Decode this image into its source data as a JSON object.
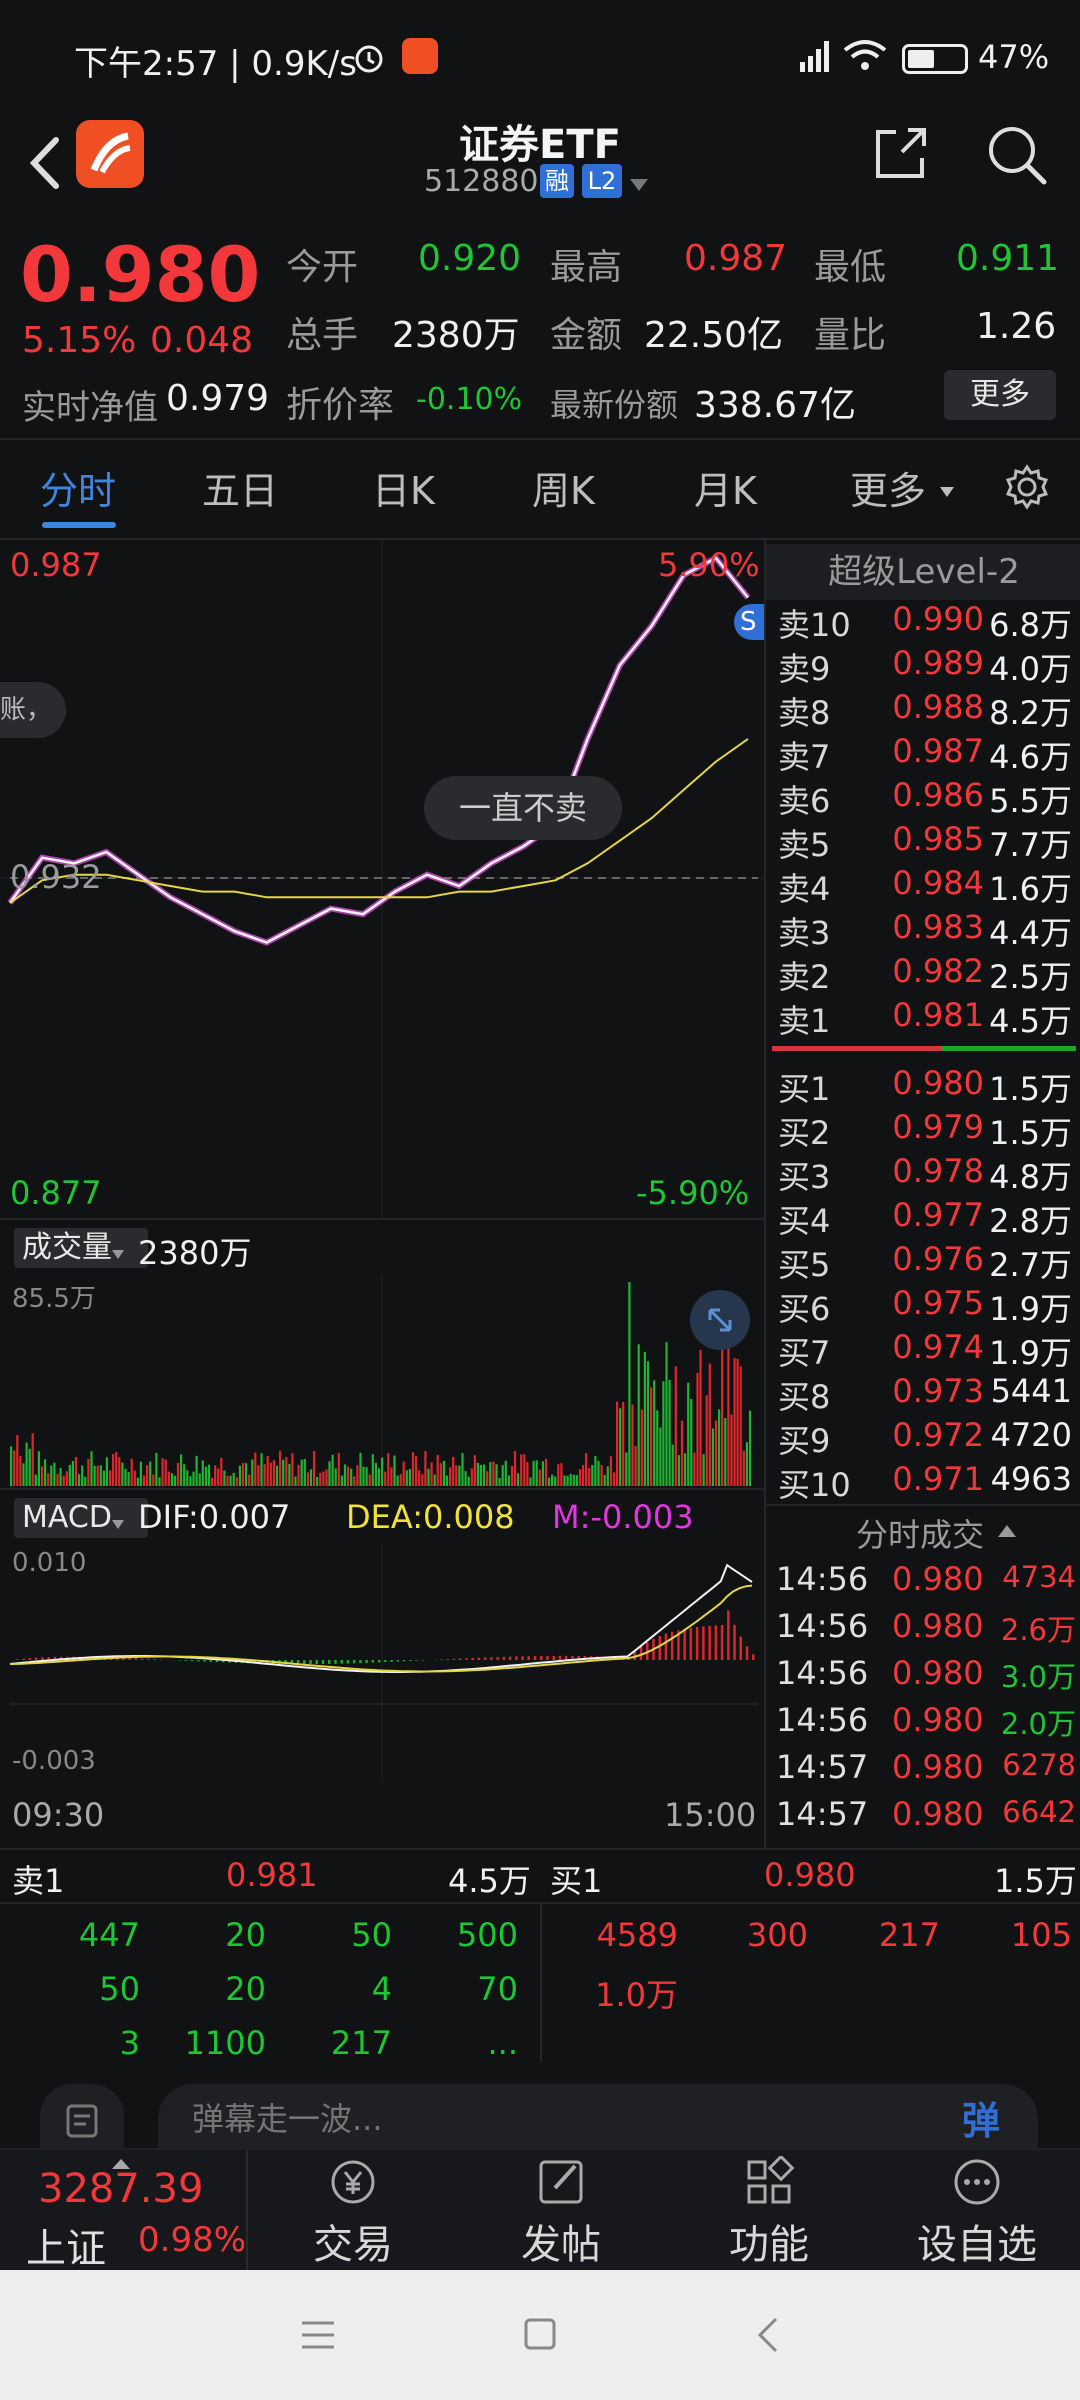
{
  "status_bar": {
    "time_speed": "下午2:57 | 0.9K/s",
    "battery": "47%"
  },
  "header": {
    "title": "证券ETF",
    "code": "512880",
    "badge_rong": "融",
    "badge_l2": "L2"
  },
  "quote": {
    "price": "0.980",
    "change_pct": "5.15%",
    "change_abs": "0.048",
    "nav_label": "实时净值",
    "nav_value": "0.979",
    "open_label": "今开",
    "open_value": "0.920",
    "high_label": "最高",
    "high_value": "0.987",
    "low_label": "最低",
    "low_value": "0.911",
    "hand_label": "总手",
    "hand_value": "2380万",
    "amount_label": "金额",
    "amount_value": "22.50亿",
    "ratio_label": "量比",
    "ratio_value": "1.26",
    "discount_label": "折价率",
    "discount_value": "-0.10%",
    "shares_label": "最新份额",
    "shares_value": "338.67亿",
    "more_label": "更多"
  },
  "tabs": [
    "分时",
    "五日",
    "日K",
    "周K",
    "月K",
    "更多"
  ],
  "chart": {
    "price_top": "0.987",
    "pct_top": "5.90%",
    "price_mid": "0.932",
    "price_bottom": "0.877",
    "pct_bottom": "-5.90%",
    "bubble": "一直不卖",
    "edge_text": "账，",
    "volume_label": "成交量",
    "volume_value": "2380万",
    "volume_max": "85.5万",
    "macd_label": "MACD",
    "dif": "DIF:0.007",
    "dea": "DEA:0.008",
    "m": "M:-0.003",
    "macd_top": "0.010",
    "macd_bottom": "-0.003",
    "time_start": "09:30",
    "time_end": "15:00",
    "s_marker": "S"
  },
  "chart_data": {
    "type": "line",
    "x": [
      "09:30",
      "15:00"
    ],
    "ylim": [
      0.877,
      0.987
    ],
    "reference": 0.932,
    "series": [
      {
        "values": [
          0.926,
          0.934,
          0.933,
          0.935,
          0.931,
          0.927,
          0.924,
          0.921,
          0.919,
          0.922,
          0.925,
          0.924,
          0.928,
          0.931,
          0.929,
          0.933,
          0.936,
          0.94,
          0.955,
          0.968,
          0.975,
          0.984,
          0.987,
          0.98
        ]
      },
      {
        "values": [
          0.926,
          0.93,
          0.931,
          0.931,
          0.93,
          0.929,
          0.928,
          0.928,
          0.927,
          0.927,
          0.927,
          0.927,
          0.927,
          0.927,
          0.928,
          0.928,
          0.929,
          0.93,
          0.933,
          0.937,
          0.941,
          0.946,
          0.951,
          0.955
        ]
      }
    ]
  },
  "orderbook": {
    "title": "超级Level-2",
    "asks": [
      {
        "label": "卖10",
        "price": "0.990",
        "vol": "6.8万"
      },
      {
        "label": "卖9",
        "price": "0.989",
        "vol": "4.0万"
      },
      {
        "label": "卖8",
        "price": "0.988",
        "vol": "8.2万"
      },
      {
        "label": "卖7",
        "price": "0.987",
        "vol": "4.6万"
      },
      {
        "label": "卖6",
        "price": "0.986",
        "vol": "5.5万"
      },
      {
        "label": "卖5",
        "price": "0.985",
        "vol": "7.7万"
      },
      {
        "label": "卖4",
        "price": "0.984",
        "vol": "1.6万"
      },
      {
        "label": "卖3",
        "price": "0.983",
        "vol": "4.4万"
      },
      {
        "label": "卖2",
        "price": "0.982",
        "vol": "2.5万"
      },
      {
        "label": "卖1",
        "price": "0.981",
        "vol": "4.5万"
      }
    ],
    "bids": [
      {
        "label": "买1",
        "price": "0.980",
        "vol": "1.5万"
      },
      {
        "label": "买2",
        "price": "0.979",
        "vol": "1.5万"
      },
      {
        "label": "买3",
        "price": "0.978",
        "vol": "4.8万"
      },
      {
        "label": "买4",
        "price": "0.977",
        "vol": "2.8万"
      },
      {
        "label": "买5",
        "price": "0.976",
        "vol": "2.7万"
      },
      {
        "label": "买6",
        "price": "0.975",
        "vol": "1.9万"
      },
      {
        "label": "买7",
        "price": "0.974",
        "vol": "1.9万"
      },
      {
        "label": "买8",
        "price": "0.973",
        "vol": "5441"
      },
      {
        "label": "买9",
        "price": "0.972",
        "vol": "4720"
      },
      {
        "label": "买10",
        "price": "0.971",
        "vol": "4963"
      }
    ]
  },
  "ticks": {
    "title": "分时成交",
    "rows": [
      {
        "time": "14:56",
        "price": "0.980",
        "vol": "4734",
        "color": "#f2383a"
      },
      {
        "time": "14:56",
        "price": "0.980",
        "vol": "2.6万",
        "color": "#f2383a"
      },
      {
        "time": "14:56",
        "price": "0.980",
        "vol": "3.0万",
        "color": "#1fc633"
      },
      {
        "time": "14:56",
        "price": "0.980",
        "vol": "2.0万",
        "color": "#1fc633"
      },
      {
        "time": "14:57",
        "price": "0.980",
        "vol": "6278",
        "color": "#f2383a"
      },
      {
        "time": "14:57",
        "price": "0.980",
        "vol": "6642",
        "color": "#f2383a"
      }
    ]
  },
  "queue": {
    "sell_label": "卖1",
    "sell_price": "0.981",
    "sell_vol": "4.5万",
    "buy_label": "买1",
    "buy_price": "0.980",
    "buy_vol": "1.5万",
    "sell_orders": [
      "447",
      "20",
      "50",
      "500",
      "50",
      "20",
      "4",
      "70",
      "3",
      "1100",
      "217",
      "..."
    ],
    "buy_orders": [
      "4589",
      "300",
      "217",
      "105",
      "1.0万"
    ]
  },
  "danmaku": {
    "placeholder": "弹幕走一波...",
    "send": "弹"
  },
  "tabbar": {
    "index_value": "3287.39",
    "index_name": "上证",
    "index_pct": "0.98%",
    "items": [
      "交易",
      "发帖",
      "功能",
      "设自选"
    ]
  }
}
